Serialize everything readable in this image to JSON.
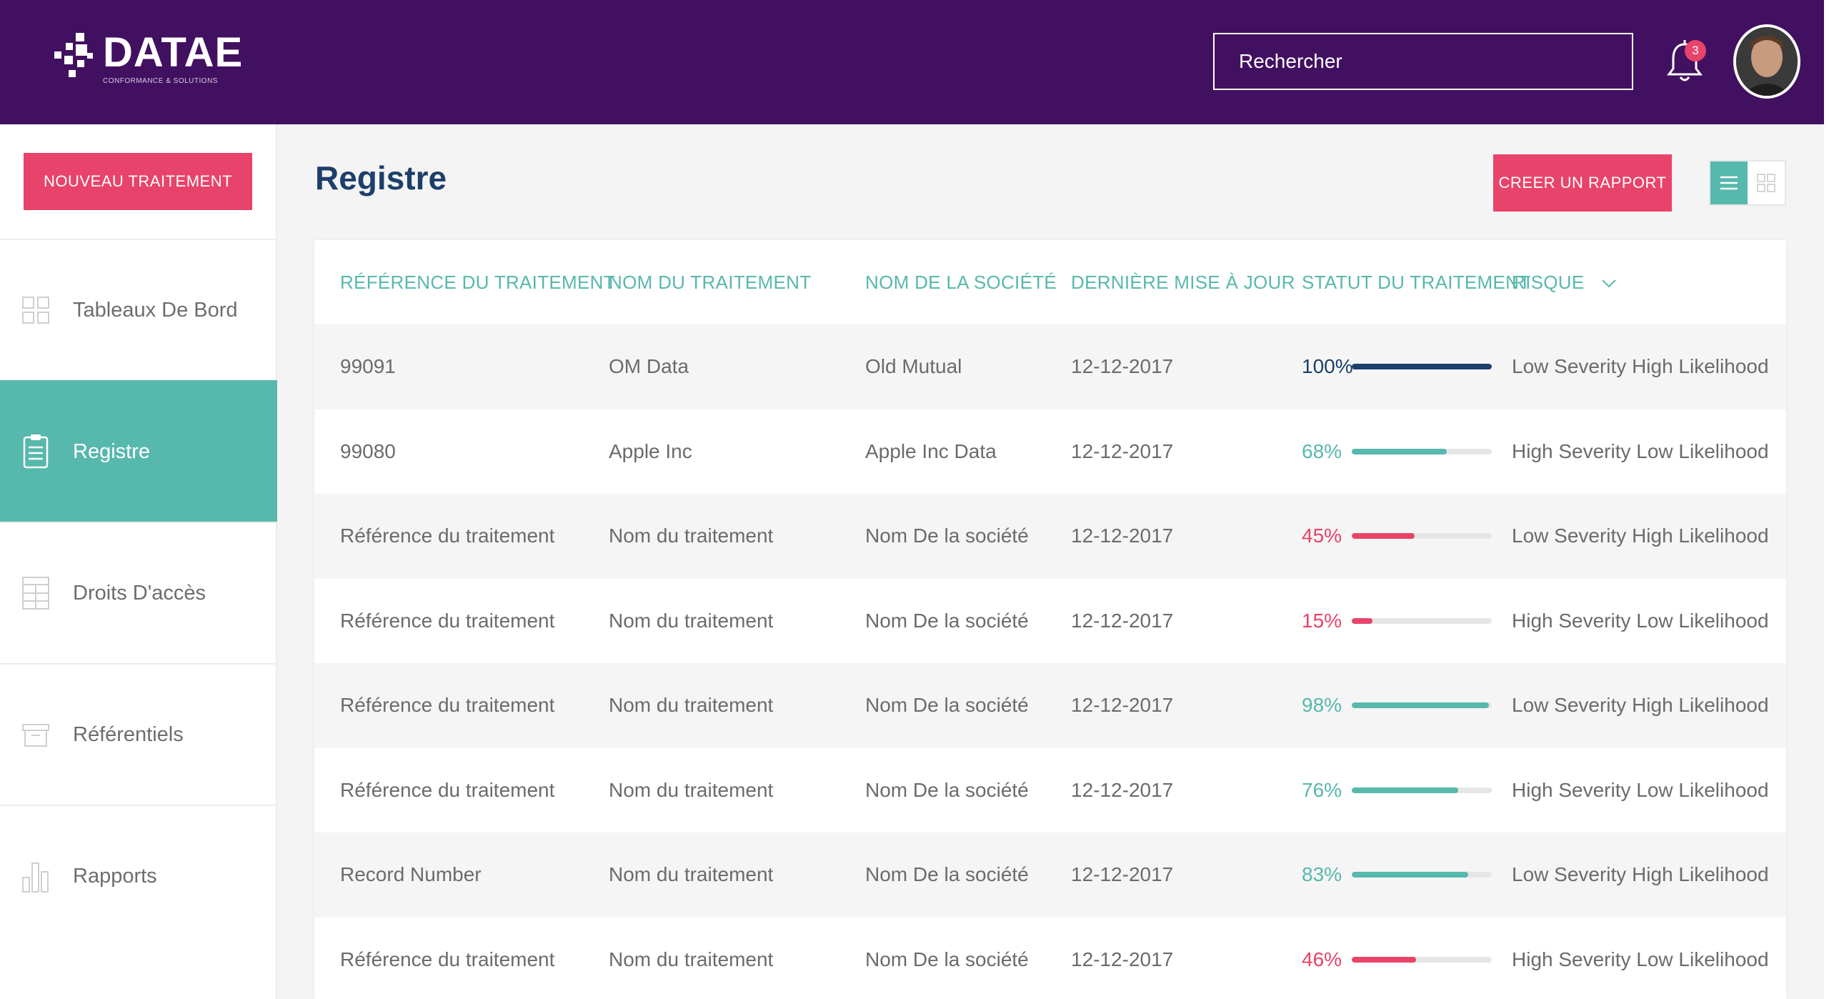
{
  "brand": {
    "name": "DATAE",
    "tagline": "CONFORMANCE & SOLUTIONS"
  },
  "search": {
    "placeholder": "Rechercher"
  },
  "notifications": {
    "count": "3"
  },
  "sidebar": {
    "new_button": "NOUVEAU TRAITEMENT",
    "items": [
      {
        "label": "Tableaux De Bord",
        "icon": "dashboard-icon",
        "active": false
      },
      {
        "label": "Registre",
        "icon": "clipboard-icon",
        "active": true
      },
      {
        "label": "Droits D'accès",
        "icon": "table-icon",
        "active": false
      },
      {
        "label": "Référentiels",
        "icon": "archive-icon",
        "active": false
      },
      {
        "label": "Rapports",
        "icon": "bar-chart-icon",
        "active": false
      }
    ]
  },
  "page": {
    "title": "Registre",
    "report_button": "CREER UN RAPPORT"
  },
  "table": {
    "columns": [
      "RÉFÉRENCE DU TRAITEMENT",
      "NOM DU TRAITEMENT",
      "NOM DE LA SOCIÉTÉ",
      "DERNIÈRE MISE À JOUR",
      "STATUT DU TRAITEMENT",
      "RISQUE"
    ],
    "rows": [
      {
        "reference": "99091",
        "name": "OM Data",
        "company": "Old Mutual",
        "updated": "12-12-2017",
        "status": 100,
        "status_label": "100%",
        "risk": "Low Severity High Likelihood"
      },
      {
        "reference": "99080",
        "name": "Apple Inc",
        "company": "Apple Inc Data",
        "updated": "12-12-2017",
        "status": 68,
        "status_label": "68%",
        "risk": "High Severity Low Likelihood"
      },
      {
        "reference": "Référence du traitement",
        "name": "Nom du traitement",
        "company": "Nom De la société",
        "updated": "12-12-2017",
        "status": 45,
        "status_label": "45%",
        "risk": "Low Severity High Likelihood"
      },
      {
        "reference": "Référence du traitement",
        "name": "Nom du traitement",
        "company": "Nom De la société",
        "updated": "12-12-2017",
        "status": 15,
        "status_label": "15%",
        "risk": "High Severity Low Likelihood"
      },
      {
        "reference": "Référence du traitement",
        "name": "Nom du traitement",
        "company": "Nom De la société",
        "updated": "12-12-2017",
        "status": 98,
        "status_label": "98%",
        "risk": "Low Severity High Likelihood"
      },
      {
        "reference": "Référence du traitement",
        "name": "Nom du traitement",
        "company": "Nom De la société",
        "updated": "12-12-2017",
        "status": 76,
        "status_label": "76%",
        "risk": "High Severity Low Likelihood"
      },
      {
        "reference": "Record Number",
        "name": "Nom du traitement",
        "company": "Nom De la société",
        "updated": "12-12-2017",
        "status": 83,
        "status_label": "83%",
        "risk": "Low Severity High Likelihood"
      },
      {
        "reference": "Référence du traitement",
        "name": "Nom du traitement",
        "company": "Nom De la société",
        "updated": "12-12-2017",
        "status": 46,
        "status_label": "46%",
        "risk": "High Severity Low Likelihood"
      }
    ]
  },
  "colors": {
    "header_bg": "#421060",
    "accent_teal": "#57b8ad",
    "accent_pink": "#e8436a",
    "complete_navy": "#1c3f6b"
  }
}
